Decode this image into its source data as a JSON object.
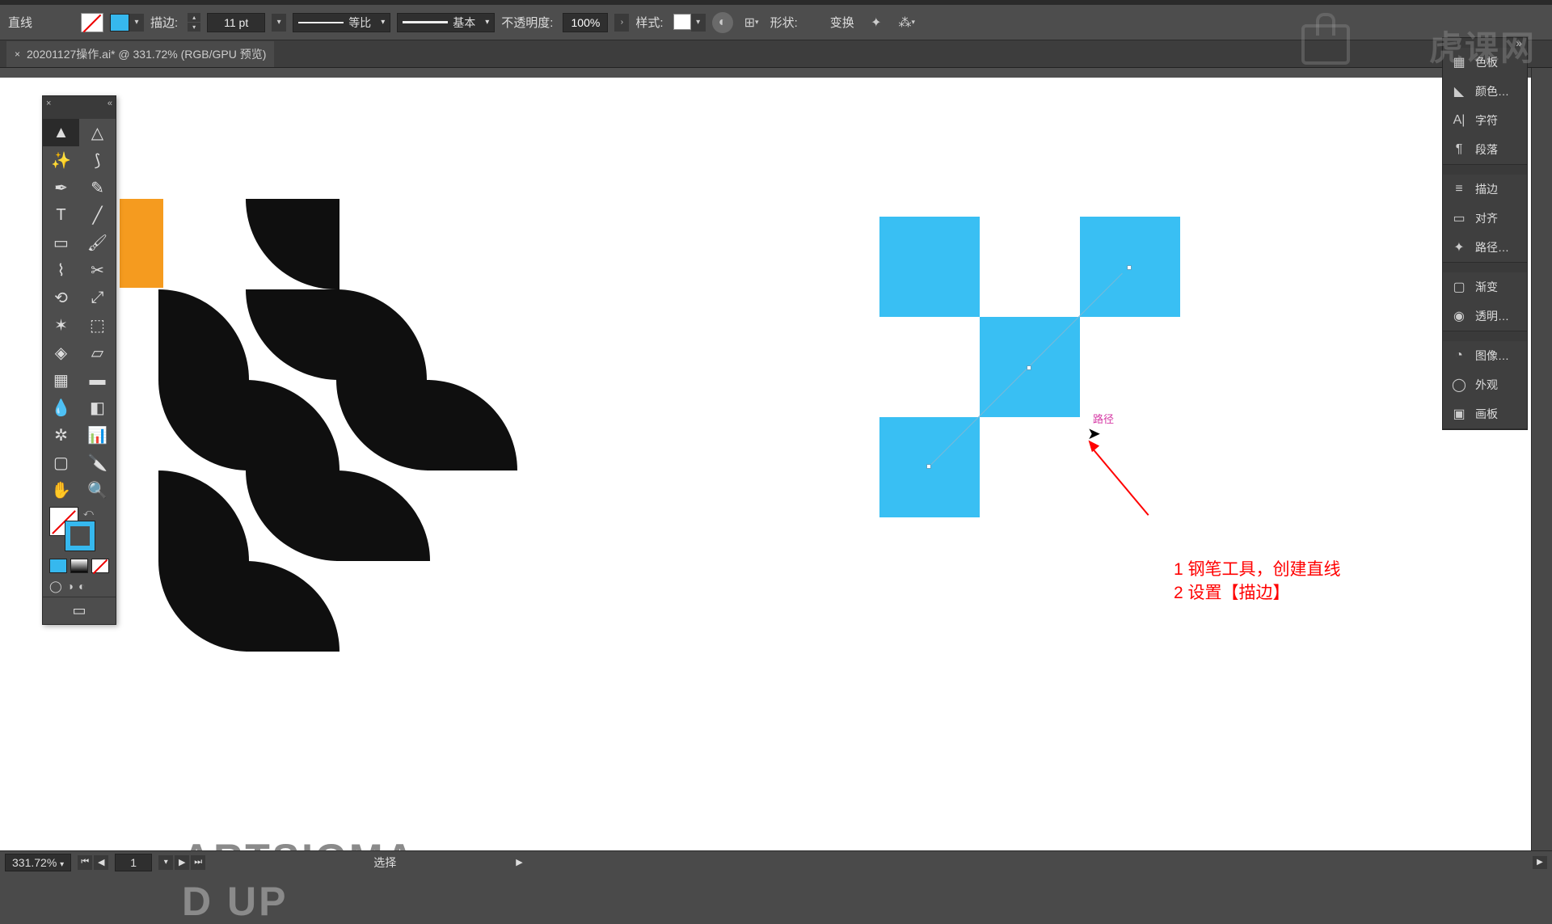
{
  "controlbar": {
    "tool_label": "直线",
    "stroke_label": "描边:",
    "stroke_value": "11 pt",
    "profile_label": "等比",
    "brush_label": "基本",
    "opacity_label": "不透明度:",
    "opacity_value": "100%",
    "style_label": "样式:",
    "shape_label": "形状:",
    "transform_label": "变换"
  },
  "doctab": {
    "title": "20201127操作.ai* @ 331.72% (RGB/GPU 预览)"
  },
  "right_panels": {
    "group1": [
      {
        "icon": "▦",
        "label": "色板"
      },
      {
        "icon": "◣",
        "label": "颜色…"
      },
      {
        "icon": "A|",
        "label": "字符"
      },
      {
        "icon": "¶",
        "label": "段落"
      }
    ],
    "group2": [
      {
        "icon": "≡",
        "label": "描边"
      },
      {
        "icon": "▭",
        "label": "对齐"
      },
      {
        "icon": "✦",
        "label": "路径…"
      }
    ],
    "group3": [
      {
        "icon": "▢",
        "label": "渐变"
      },
      {
        "icon": "◉",
        "label": "透明…"
      }
    ],
    "group4": [
      {
        "icon": "◔",
        "label": "图像…"
      },
      {
        "icon": "◯",
        "label": "外观"
      },
      {
        "icon": "▣",
        "label": "画板"
      }
    ]
  },
  "canvas": {
    "art_text_line1": "ARTSIGMA",
    "art_text_line2": "D UP",
    "smart_guide": "路径",
    "annotation_line1": "1 钢笔工具，创建直线",
    "annotation_line2": "2 设置【描边】"
  },
  "status": {
    "zoom": "331.72%",
    "artboard_no": "1",
    "tool_hint": "选择"
  },
  "watermark": "虎课网",
  "colors": {
    "accent_blue": "#39bff3",
    "orange": "#f59b1f",
    "annotation_red": "#ff0000"
  }
}
